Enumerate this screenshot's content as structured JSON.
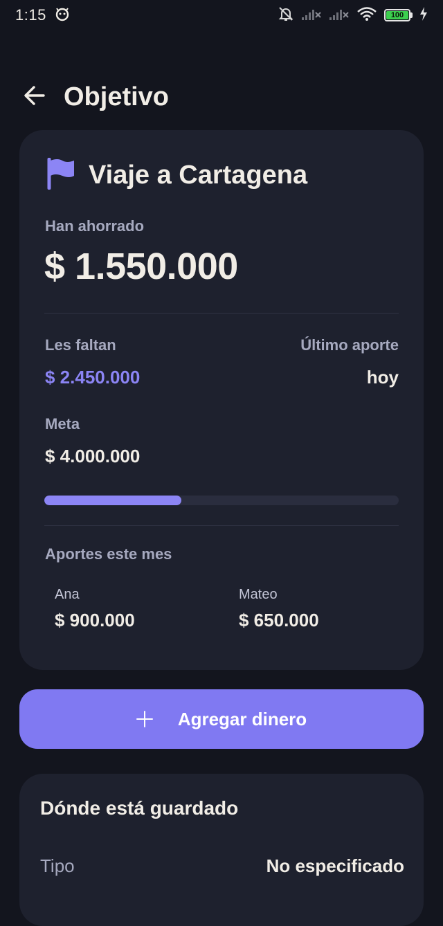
{
  "status_bar": {
    "time": "1:15",
    "battery_level": "100",
    "icons": [
      "android-face-icon",
      "bell-off-icon",
      "signal-no-service-icon",
      "signal-no-service-icon",
      "wifi-icon",
      "battery-icon",
      "charging-bolt-icon"
    ]
  },
  "header": {
    "title": "Objetivo",
    "back_icon": "arrow-left-icon"
  },
  "goal": {
    "name": "Viaje a Cartagena",
    "icon": "flag-icon",
    "saved_label": "Han ahorrado",
    "saved_amount": "$ 1.550.000",
    "missing_label": "Les faltan",
    "missing_amount": "$ 2.450.000",
    "last_contribution_label": "Último aporte",
    "last_contribution_value": "hoy",
    "target_label": "Meta",
    "target_amount": "$ 4.000.000",
    "progress_fraction": 0.3875,
    "contributions_label": "Aportes este mes",
    "contributions": [
      {
        "name": "Ana",
        "amount": "$ 900.000"
      },
      {
        "name": "Mateo",
        "amount": "$ 650.000"
      }
    ]
  },
  "add_button": {
    "label": "Agregar dinero",
    "icon": "plus-icon"
  },
  "storage": {
    "title": "Dónde está guardado",
    "type_label": "Tipo",
    "type_value": "No especificado"
  },
  "colors": {
    "background": "#13151e",
    "card": "#1e212e",
    "accent": "#8079f2",
    "accent_text": "#8b84f4",
    "muted_text": "#a6a9bf",
    "primary_text": "#f1ede6",
    "battery": "#3ccf4e"
  }
}
